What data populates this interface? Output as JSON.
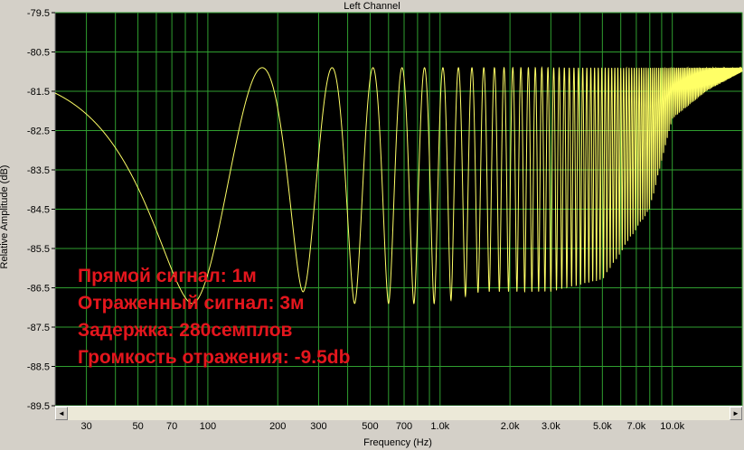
{
  "window": {
    "title": "Left Channel"
  },
  "annotations": [
    "Прямой сигнал: 1м",
    "Отраженный сигнал: 3м",
    "Задержка: 280семплов",
    "Громкость отражения: -9.5db"
  ],
  "scrollbar": {
    "left_arrow": "◄",
    "right_arrow": "►"
  },
  "colors": {
    "background": "#000000",
    "grid": "#2f9e2f",
    "line": "#ffff66",
    "annotation": "#e4161d",
    "frame": "#d4d0c8"
  },
  "chart_data": {
    "type": "line",
    "title": "Left Channel",
    "xlabel": "Frequency (Hz)",
    "ylabel": "Relative Amplitude (dB)",
    "x_scale": "log",
    "xlim": [
      22,
      20000
    ],
    "ylim": [
      -89.5,
      -79.5
    ],
    "grid": true,
    "x_tick_labels": [
      "30",
      "50",
      "70",
      "100",
      "200",
      "300",
      "500",
      "700",
      "1.0k",
      "2.0k",
      "3.0k",
      "5.0k",
      "7.0k",
      "10.0k"
    ],
    "x_tick_values": [
      30,
      50,
      70,
      100,
      200,
      300,
      500,
      700,
      1000,
      2000,
      3000,
      5000,
      7000,
      10000
    ],
    "y_ticks": [
      -79.5,
      -80.5,
      -81.5,
      -82.5,
      -83.5,
      -84.5,
      -85.5,
      -86.5,
      -87.5,
      -88.5,
      -89.5
    ],
    "series": [
      {
        "comb_filter": {
          "peak_db": -80.9,
          "notch_db_at_20hz": -81.6,
          "reflection_delay_samples": 280,
          "reflection_gain_db": -9.5,
          "first_notch_hz": 86,
          "notch_spacing_hz": 172,
          "max_db_start": -80.9,
          "peak_points": [
            [
              170,
              -80.9
            ],
            [
              345,
              -80.9
            ],
            [
              520,
              -80.9
            ],
            [
              690,
              -80.9
            ],
            [
              1200,
              -80.9
            ],
            [
              4000,
              -80.95
            ],
            [
              15000,
              -80.95
            ]
          ],
          "notch_points": [
            [
              90,
              -86.9
            ],
            [
              260,
              -86.6
            ],
            [
              430,
              -86.9
            ],
            [
              600,
              -86.9
            ],
            [
              1000,
              -86.9
            ],
            [
              1500,
              -86.6
            ],
            [
              3000,
              -86.6
            ],
            [
              5000,
              -86.3
            ],
            [
              8000,
              -84.5
            ],
            [
              10000,
              -82.2
            ],
            [
              14000,
              -81.5
            ],
            [
              20000,
              -81.0
            ]
          ]
        }
      }
    ]
  }
}
